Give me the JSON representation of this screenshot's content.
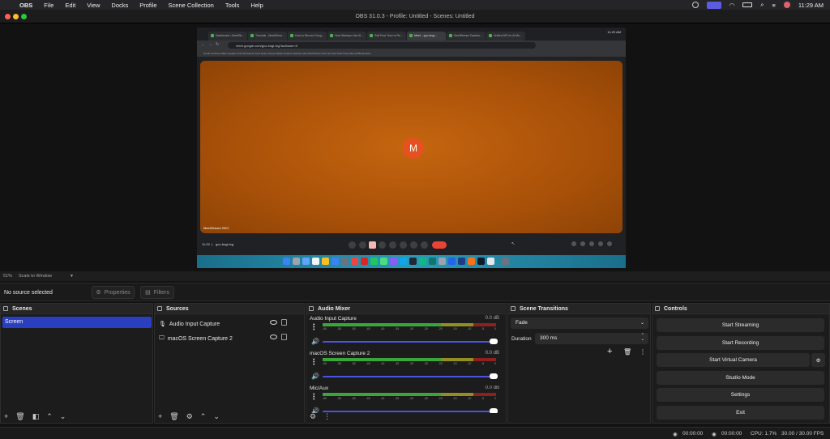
{
  "menubar": {
    "app": "OBS",
    "items": [
      "File",
      "Edit",
      "View",
      "Docks",
      "Profile",
      "Scene Collection",
      "Tools",
      "Help"
    ],
    "clock": "11:29 AM"
  },
  "window": {
    "title": "OBS 31.0.3 - Profile: Untitled - Scenes: Untitled"
  },
  "browser": {
    "tabs": [
      "Dashboard • MeetStr...",
      "Tutorials - MeetStrea...",
      "How to Record Goog...",
      "How Startups Use Al...",
      "Edit Post 'How to Re...",
      "Meet – gco-bngi-...",
      "MeetStream Dashbo...",
      "Unified API for AI Me..."
    ],
    "clock": "11:29 AM",
    "url": "meet.google.com/gco-bngi-txg?authuser=0",
    "bookmarks": "Gmail   YouTube   Maps   Google's Pub   KPI Ads   AI Tools   Notion   Rover Media   Vendors   ClickUp   Jobs   MeetStream   Dont Get Sell   Trello   Favourites   All Bookmarks"
  },
  "meet": {
    "avatar_letter": "M",
    "participant_name": "MeetStream SEO",
    "time": "11:29",
    "meeting_code": "gco-bngi-txg"
  },
  "preview_bar": {
    "zoom": "51%",
    "scale_mode": "Scale to Window"
  },
  "context": {
    "selection": "No source selected",
    "properties": "Properties",
    "filters": "Filters"
  },
  "scenes": {
    "title": "Scenes",
    "items": [
      "Screen"
    ]
  },
  "sources": {
    "title": "Sources",
    "items": [
      "Audio Input Capture",
      "macOS Screen Capture 2"
    ]
  },
  "mixer": {
    "title": "Audio Mixer",
    "channels": [
      {
        "name": "Audio Input Capture",
        "db": "0.0 dB"
      },
      {
        "name": "macOS Screen Capture 2",
        "db": "0.0 dB"
      },
      {
        "name": "Mic/Aux",
        "db": "0.0 dB"
      }
    ],
    "scale": [
      "-60",
      "-55",
      "-50",
      "-45",
      "-40",
      "-35",
      "-30",
      "-25",
      "-20",
      "-15",
      "-10",
      "-5",
      "0"
    ]
  },
  "transitions": {
    "title": "Scene Transitions",
    "type": "Fade",
    "duration_label": "Duration",
    "duration_value": "300 ms"
  },
  "controls": {
    "title": "Controls",
    "start_streaming": "Start Streaming",
    "start_recording": "Start Recording",
    "start_virtual_camera": "Start Virtual Camera",
    "studio_mode": "Studio Mode",
    "settings": "Settings",
    "exit": "Exit"
  },
  "status": {
    "stream_time": "00:00:00",
    "rec_time": "00:00:00",
    "cpu": "CPU: 1.7%",
    "fps": "30.00 / 30.00 FPS"
  },
  "colors": {
    "accent": "#2a3fbf",
    "meet_tile": "#b85a0c",
    "avatar": "#e5511f",
    "meter_green": "#3aa53a",
    "meter_yellow": "#8f8f24",
    "meter_red": "#8e2020"
  }
}
